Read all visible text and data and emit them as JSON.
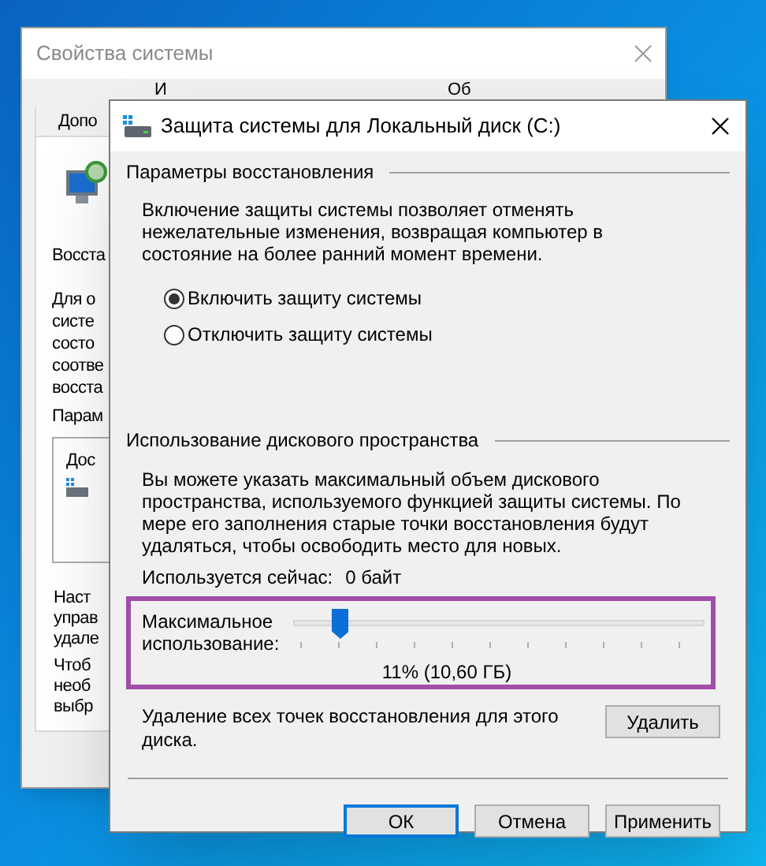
{
  "background_window": {
    "title": "Свойства системы",
    "tabs_row_1": [
      {
        "label": "И",
        "selected": false
      },
      {
        "label": "Об",
        "selected": false
      }
    ],
    "tabs_row_2": [
      {
        "label": "Допо",
        "selected": false
      }
    ],
    "section_heading": "Восста",
    "paragraph_lines": [
      "Для о",
      "систе",
      "состо",
      "соотве",
      "восста"
    ],
    "settings_heading": "Парам",
    "drive_list": {
      "column_heading": "Дос"
    },
    "configure_lines": [
      "Наст",
      "управ",
      "удале"
    ],
    "create_lines": [
      "Чтоб",
      "необ",
      "выбр"
    ]
  },
  "dialog": {
    "title": "Защита системы для Локальный диск (C:)",
    "restore_settings": {
      "heading": "Параметры восстановления",
      "description": "Включение защиты системы позволяет отменять нежелательные изменения, возвращая компьютер в состояние на более ранний момент времени.",
      "options": [
        {
          "label": "Включить защиту системы",
          "selected": true
        },
        {
          "label": "Отключить защиту системы",
          "selected": false
        }
      ]
    },
    "disk_usage": {
      "heading": "Использование дискового пространства",
      "description": "Вы можете указать максимальный объем дискового пространства, используемого функцией защиты системы. По мере его заполнения старые точки восстановления будут удаляться, чтобы освободить место для новых.",
      "current_usage_label": "Используется сейчас:",
      "current_usage_value": "0 байт",
      "max_usage": {
        "label": "Максимальное использование:",
        "level": 0.11,
        "reading": "11% (10,60 ГБ)"
      },
      "delete_text": "Удаление всех точек восстановления для этого диска.",
      "delete_button": "Удалить"
    },
    "buttons": [
      {
        "label": "ОК",
        "default": true
      },
      {
        "label": "Отмена",
        "default": false
      },
      {
        "label": "Применить",
        "default": false
      }
    ]
  }
}
